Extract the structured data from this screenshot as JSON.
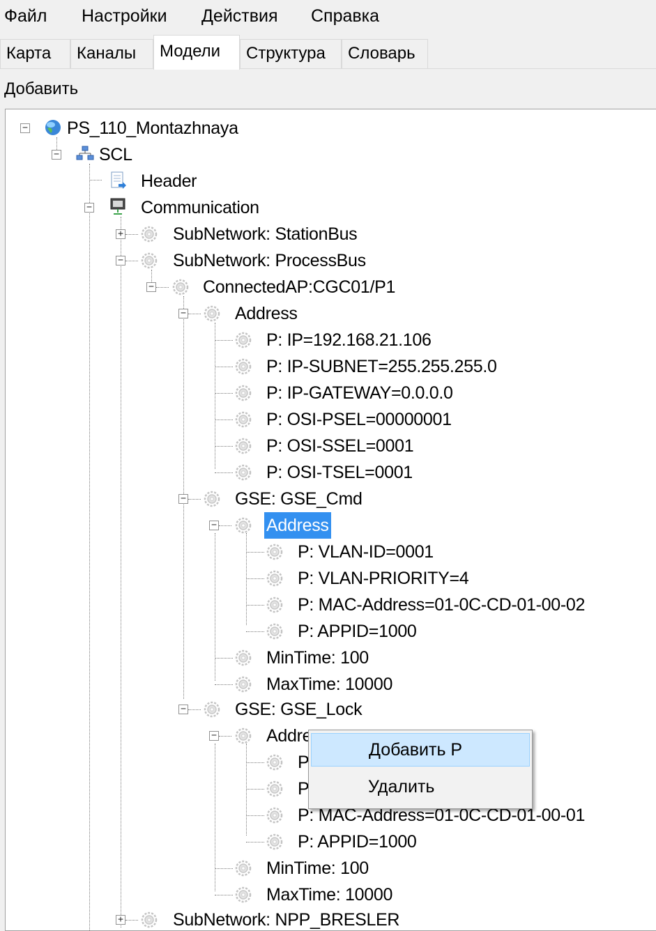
{
  "menu": {
    "file": "Файл",
    "settings": "Настройки",
    "actions": "Действия",
    "help": "Справка"
  },
  "tabs": {
    "map": "Карта",
    "channels": "Каналы",
    "models": "Модели",
    "structure": "Структура",
    "dictionary": "Словарь",
    "active": "models"
  },
  "toolbar": {
    "add": "Добавить"
  },
  "tree": {
    "root": "PS_110_Montazhnaya",
    "scl": "SCL",
    "header": "Header",
    "communication": "Communication",
    "subnet_station": "SubNetwork: StationBus",
    "subnet_process": "SubNetwork: ProcessBus",
    "connected_ap": "ConnectedAP:CGC01/P1",
    "address_1": "Address",
    "p_ip": "P: IP=192.168.21.106",
    "p_subnet": "P: IP-SUBNET=255.255.255.0",
    "p_gateway": "P: IP-GATEWAY=0.0.0.0",
    "p_psel": "P: OSI-PSEL=00000001",
    "p_ssel": "P: OSI-SSEL=0001",
    "p_tsel": "P: OSI-TSEL=0001",
    "gse_cmd": "GSE: GSE_Cmd",
    "address_cmd": "Address",
    "cmd_vlan_id": "P: VLAN-ID=0001",
    "cmd_vlan_prio": "P: VLAN-PRIORITY=4",
    "cmd_mac": "P: MAC-Address=01-0C-CD-01-00-02",
    "cmd_appid": "P: APPID=1000",
    "cmd_mintime": "MinTime: 100",
    "cmd_maxtime": "MaxTime: 10000",
    "gse_lock": "GSE: GSE_Lock",
    "address_lock": "Addre",
    "lock_p1": "P",
    "lock_p2": "P",
    "lock_mac": "P: MAC-Address=01-0C-CD-01-00-01",
    "lock_appid": "P: APPID=1000",
    "lock_mintime": "MinTime: 100",
    "lock_maxtime": "MaxTime: 10000",
    "subnet_npp": "SubNetwork: NPP_BRESLER",
    "selected_item": "address_cmd"
  },
  "context_menu": {
    "add_p": "Добавить P",
    "delete": "Удалить"
  },
  "icons": {
    "root": "globe-icon",
    "scl": "network-icon",
    "header": "document-icon",
    "communication": "computer-icon",
    "node": "gear-icon"
  },
  "colors": {
    "selection": "#3390f0",
    "menu_hover": "#cde8ff"
  }
}
